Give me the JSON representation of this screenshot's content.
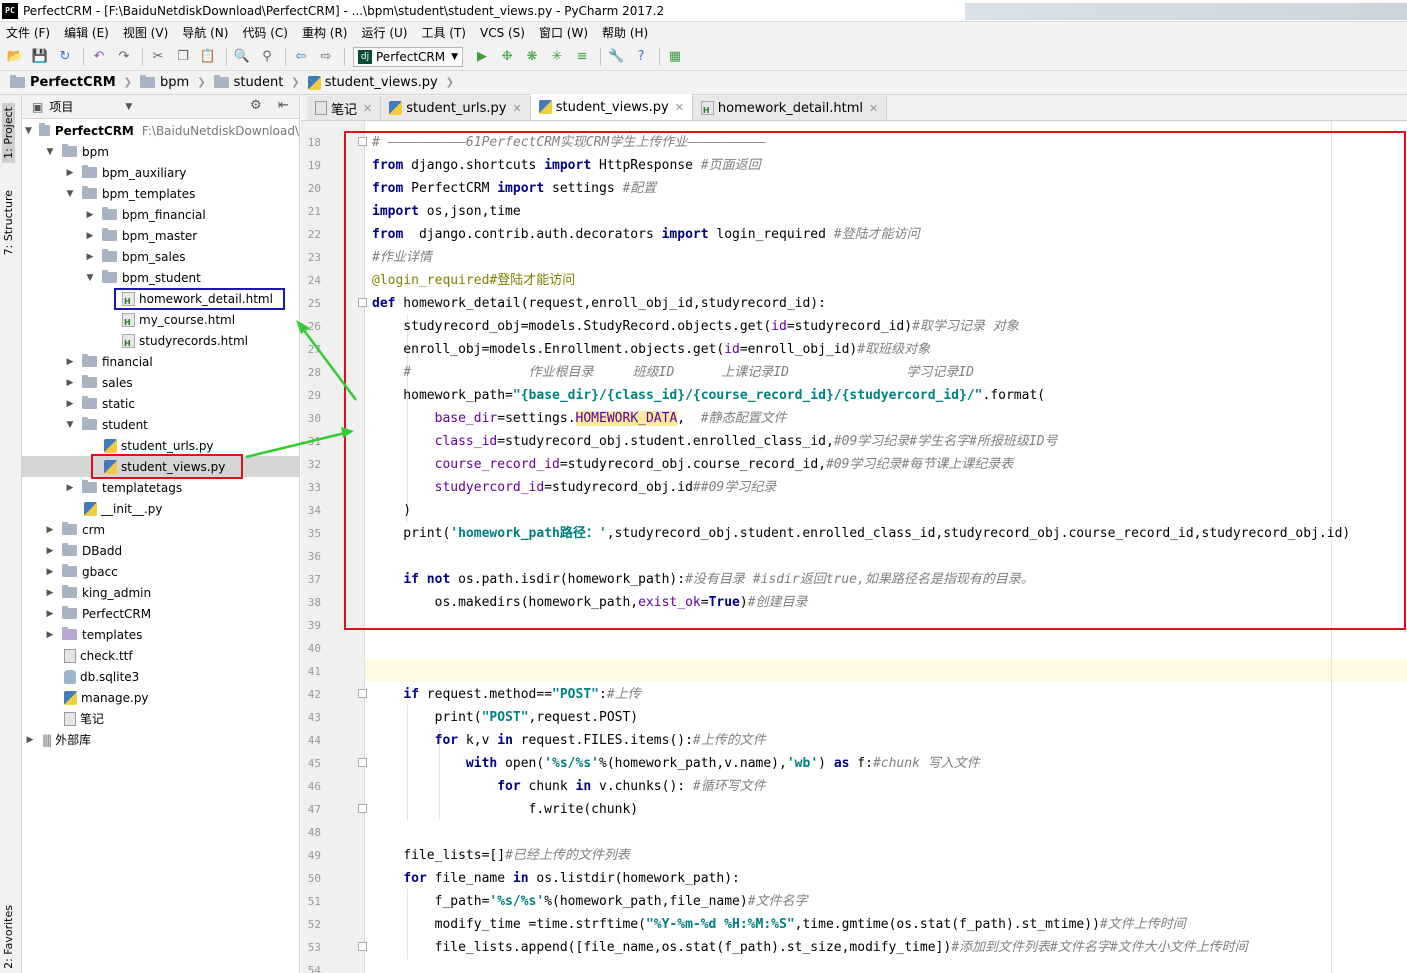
{
  "window": {
    "title": "PerfectCRM - [F:\\BaiduNetdiskDownload\\PerfectCRM] - ...\\bpm\\student\\student_views.py - PyCharm 2017.2",
    "app_icon": "PC"
  },
  "menu": [
    "文件 (F)",
    "编辑 (E)",
    "视图 (V)",
    "导航 (N)",
    "代码 (C)",
    "重构 (R)",
    "运行 (U)",
    "工具 (T)",
    "VCS (S)",
    "窗口 (W)",
    "帮助 (H)"
  ],
  "toolbar": {
    "run_config": "PerfectCRM"
  },
  "breadcrumb": [
    "PerfectCRM",
    "bpm",
    "student",
    "student_views.py"
  ],
  "side_tabs": {
    "project": "1: Project",
    "structure": "7: Structure",
    "favorites": "2: Favorites"
  },
  "project_panel": {
    "header": "项目",
    "items": [
      {
        "label": "PerfectCRM",
        "path": "F:\\BaiduNetdiskDownload\\"
      },
      {
        "label": "bpm"
      },
      {
        "label": "bpm_auxiliary"
      },
      {
        "label": "bpm_templates"
      },
      {
        "label": "bpm_financial"
      },
      {
        "label": "bpm_master"
      },
      {
        "label": "bpm_sales"
      },
      {
        "label": "bpm_student"
      },
      {
        "label": "homework_detail.html"
      },
      {
        "label": "my_course.html"
      },
      {
        "label": "studyrecords.html"
      },
      {
        "label": "financial"
      },
      {
        "label": "sales"
      },
      {
        "label": "static"
      },
      {
        "label": "student"
      },
      {
        "label": "student_urls.py"
      },
      {
        "label": "student_views.py"
      },
      {
        "label": "templatetags"
      },
      {
        "label": "__init__.py"
      },
      {
        "label": "crm"
      },
      {
        "label": "DBadd"
      },
      {
        "label": "gbacc"
      },
      {
        "label": "king_admin"
      },
      {
        "label": "PerfectCRM"
      },
      {
        "label": "templates"
      },
      {
        "label": "check.ttf"
      },
      {
        "label": "db.sqlite3"
      },
      {
        "label": "manage.py"
      },
      {
        "label": "笔记"
      },
      {
        "label": "外部库"
      }
    ]
  },
  "editor_tabs": [
    "笔记",
    "student_urls.py",
    "student_views.py",
    "homework_detail.html"
  ],
  "code": {
    "line_numbers": [
      "18",
      "19",
      "20",
      "21",
      "22",
      "23",
      "24",
      "25",
      "26",
      "27",
      "28",
      "29",
      "30",
      "31",
      "32",
      "33",
      "34",
      "35",
      "36",
      "37",
      "38",
      "39",
      "40",
      "41",
      "42",
      "43",
      "44",
      "45",
      "46",
      "47",
      "48",
      "49",
      "50",
      "51",
      "52",
      "53",
      "54"
    ],
    "lines": [
      "# ——————————61PerfectCRM实现CRM学生上传作业——————————",
      "from django.shortcuts import HttpResponse #页面返回",
      "from PerfectCRM import settings #配置",
      "import os,json,time",
      "from  django.contrib.auth.decorators import login_required #登陆才能访问",
      "#作业详情",
      "@login_required#登陆才能访问",
      "def homework_detail(request,enroll_obj_id,studyrecord_id):",
      "    studyrecord_obj=models.StudyRecord.objects.get(id=studyrecord_id)#取学习记录 对象",
      "    enroll_obj=models.Enrollment.objects.get(id=enroll_obj_id)#取班级对象",
      "    #               作业根目录     班级ID      上课记录ID               学习记录ID",
      "    homework_path=\"{base_dir}/{class_id}/{course_record_id}/{studyercord_id}/\".format(",
      "        base_dir=settings.HOMEWORK_DATA,  #静态配置文件",
      "        class_id=studyrecord_obj.student.enrolled_class_id,#09学习纪录#学生名字#所报班级ID号",
      "        course_record_id=studyrecord_obj.course_record_id,#09学习纪录#每节课上课纪录表",
      "        studyercord_id=studyrecord_obj.id##09学习纪录",
      "    )",
      "    print('homework_path路径：',studyrecord_obj.student.enrolled_class_id,studyrecord_obj.course_record_id,studyrecord_obj.id)",
      "",
      "    if not os.path.isdir(homework_path):#没有目录 #isdir返回true,如果路径名是指现有的目录。",
      "        os.makedirs(homework_path,exist_ok=True)#创建目录",
      "",
      "",
      "",
      "    if request.method==\"POST\":#上传",
      "        print(\"POST\",request.POST)",
      "        for k,v in request.FILES.items():#上传的文件",
      "            with open('%s/%s'%(homework_path,v.name),'wb') as f:#chunk 写入文件",
      "                for chunk in v.chunks(): #循环写文件",
      "                    f.write(chunk)",
      "",
      "    file_lists=[]#已经上传的文件列表",
      "    for file_name in os.listdir(homework_path):",
      "        f_path='%s/%s'%(homework_path,file_name)#文件名字",
      "        modify_time =time.strftime(\"%Y-%m-%d %H:%M:%S\",time.gmtime(os.stat(f_path).st_mtime))#文件上传时间",
      "        file_lists.append([file_name,os.stat(f_path).st_size,modify_time])#添加到文件列表#文件名字#文件大小文件上传时间",
      ""
    ]
  },
  "annotation_colors": {
    "red_box": "#e0101a",
    "blue_box": "#1a1aa8",
    "arrows": "#33cc33"
  }
}
